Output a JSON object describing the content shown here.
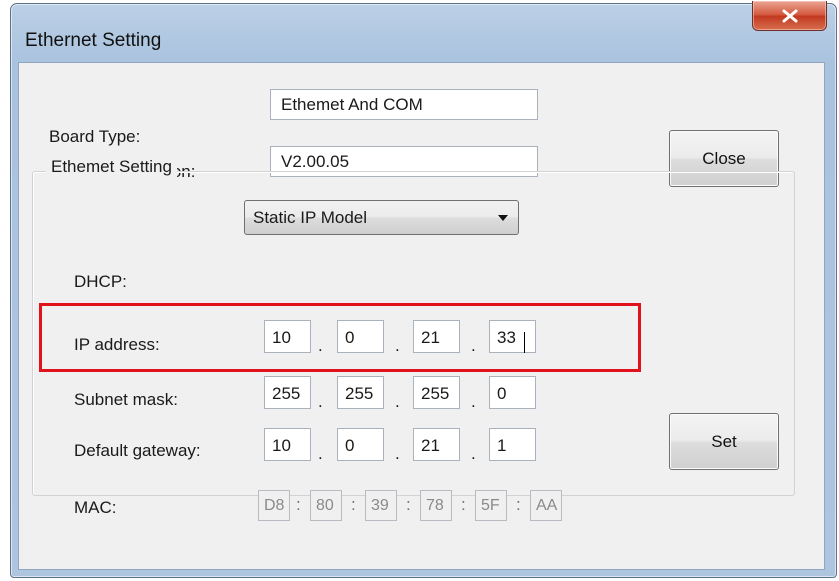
{
  "window": {
    "title": "Ethernet Setting"
  },
  "board": {
    "type_label": "Board Type:",
    "type_value": "Ethemet And COM",
    "version_label": "Board Soft Version:",
    "version_value": "V2.00.05"
  },
  "buttons": {
    "close": "Close",
    "set": "Set"
  },
  "group": {
    "title": "Ethemet Setting",
    "dhcp_label": "DHCP:",
    "dhcp_value": "Static IP Model",
    "ip_label": "IP address:",
    "ip": [
      "10",
      "0",
      "21",
      "33"
    ],
    "subnet_label": "Subnet mask:",
    "subnet": [
      "255",
      "255",
      "255",
      "0"
    ],
    "gateway_label": "Default gateway:",
    "gateway": [
      "10",
      "0",
      "21",
      "1"
    ],
    "mac_label": "MAC:",
    "mac": [
      "D8",
      "80",
      "39",
      "78",
      "5F",
      "AA"
    ],
    "dot": ".",
    "colon": ":"
  },
  "colors": {
    "highlight": "#e0131d",
    "close_button": "#c8452b"
  },
  "icons": {
    "close": "close-icon",
    "dropdown": "chevron-down-icon"
  }
}
